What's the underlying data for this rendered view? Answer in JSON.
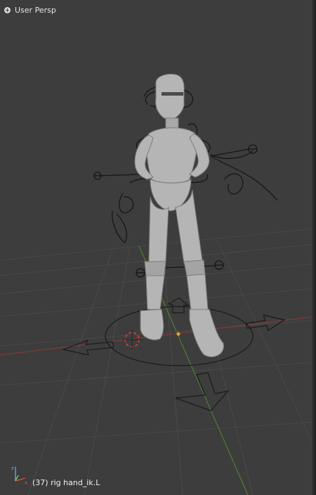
{
  "viewport": {
    "view_name": "User Persp",
    "status": "(37) rig hand_ik.L"
  },
  "icons": {
    "view_menu": "view-menu-icon",
    "axis_gizmo": "axis-gizmo-icon",
    "cursor_3d": "3d-cursor-icon",
    "origin": "origin-dot-icon"
  },
  "colors": {
    "background": "#3d3d3d",
    "grid": "#4a4a4a",
    "x_axis": "#8c3a3a",
    "y_axis": "#4f8a2d",
    "mesh": "#b7b7b7",
    "origin": "#e39a3b"
  }
}
